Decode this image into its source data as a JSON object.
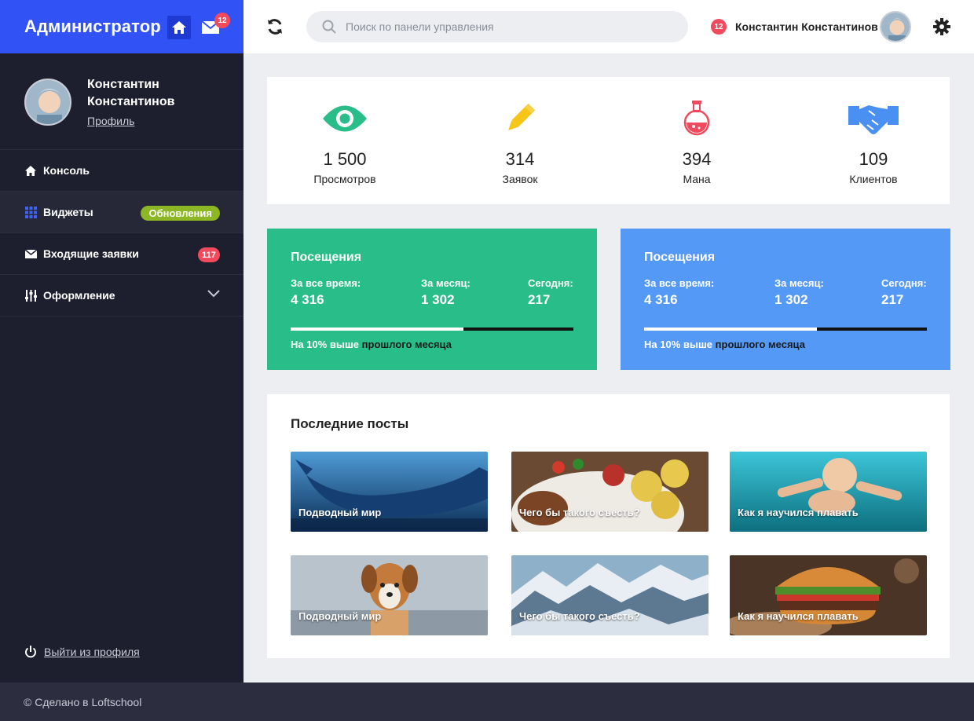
{
  "brand": {
    "title": "Администратор",
    "mail_count": "12",
    "accent": "#3152f5"
  },
  "profile": {
    "name": "Константин Константинов",
    "link": "Профиль"
  },
  "nav": {
    "items": [
      {
        "label": "Консоль",
        "icon": "home-icon"
      },
      {
        "label": "Виджеты",
        "icon": "grid-icon",
        "pill": "Обновления",
        "active": true
      },
      {
        "label": "Входящие заявки",
        "icon": "mail-icon",
        "badge": "117"
      },
      {
        "label": "Оформление",
        "icon": "sliders-icon"
      }
    ]
  },
  "logout": "Выйти из профиля",
  "footer": "© Сделано в Loftschool",
  "header": {
    "search_placeholder": "Поиск по панели управления",
    "notif_count": "12",
    "user_name": "Константин Константинов"
  },
  "stats": [
    {
      "value": "1 500",
      "label": "Просмотров",
      "icon": "eye-icon",
      "color": "#29bd8a"
    },
    {
      "value": "314",
      "label": "Заявок",
      "icon": "pencil-icon",
      "color": "#f5c518"
    },
    {
      "value": "394",
      "label": "Мана",
      "icon": "potion-icon",
      "color": "#f2495c"
    },
    {
      "value": "109",
      "label": "Клиентов",
      "icon": "handshake-icon",
      "color": "#4a90f2"
    }
  ],
  "visits": [
    {
      "title": "Посещения",
      "color": "#29bd8a",
      "all_label": "За все время:",
      "all_value": "4 316",
      "month_label": "За месяц:",
      "month_value": "1 302",
      "today_label": "Сегодня:",
      "today_value": "217",
      "progress": 0.61,
      "note_a": "На 10% выше",
      "note_b": "прошлого месяца"
    },
    {
      "title": "Посещения",
      "color": "#5499f5",
      "all_label": "За все время:",
      "all_value": "4 316",
      "month_label": "За месяц:",
      "month_value": "1 302",
      "today_label": "Сегодня:",
      "today_value": "217",
      "progress": 0.61,
      "note_a": "На 10% выше",
      "note_b": "прошлого месяца"
    }
  ],
  "posts": {
    "title": "Последние посты",
    "items": [
      {
        "title": "Подводный мир",
        "image": "whale-image"
      },
      {
        "title": "Чего бы такого съесть?",
        "image": "food-plate-image"
      },
      {
        "title": "Как я научился плавать",
        "image": "swimming-baby-image"
      },
      {
        "title": "Подводный мир",
        "image": "puppy-image"
      },
      {
        "title": "Чего бы такого съесть?",
        "image": "mountains-image"
      },
      {
        "title": "Как я научился плавать",
        "image": "burger-image"
      }
    ]
  }
}
